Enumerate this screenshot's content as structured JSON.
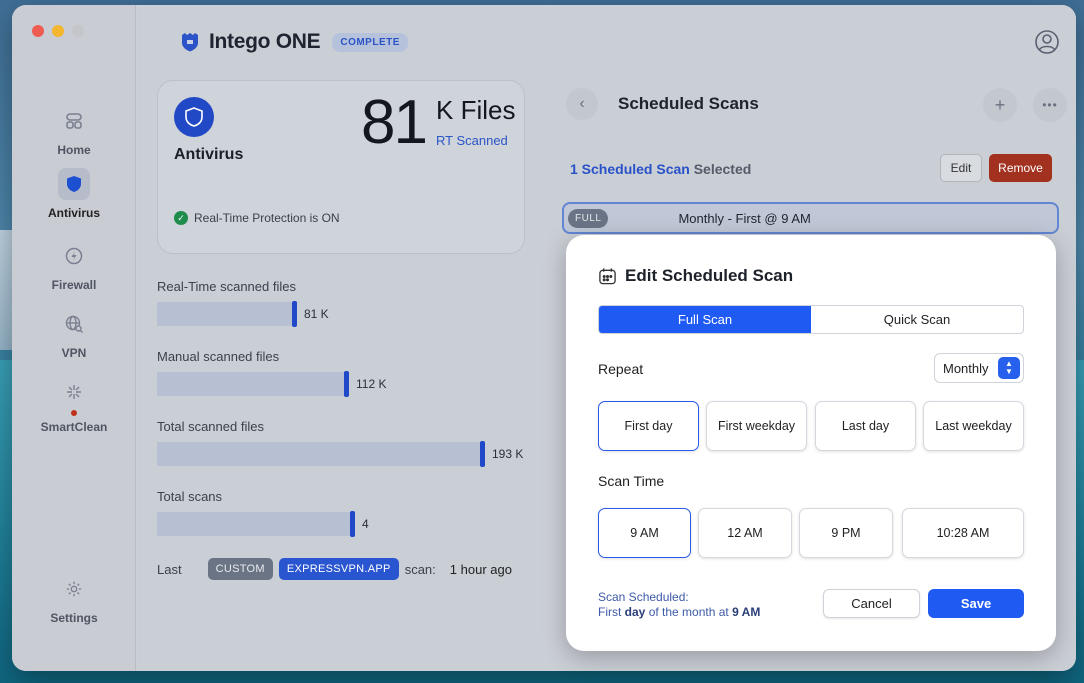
{
  "app": {
    "name": "Intego ONE",
    "edition": "COMPLETE"
  },
  "sidebar": {
    "items": [
      {
        "label": "Home",
        "icon": "home-grid-icon"
      },
      {
        "label": "Antivirus",
        "icon": "shield-icon",
        "active": true
      },
      {
        "label": "Firewall",
        "icon": "firewall-icon"
      },
      {
        "label": "VPN",
        "icon": "vpn-globe-icon"
      },
      {
        "label": "SmartClean",
        "icon": "sparkle-icon",
        "alert": true
      }
    ],
    "settings_label": "Settings"
  },
  "antivirus": {
    "title": "Antivirus",
    "count": "81",
    "count_unit": "K Files",
    "count_sub": "RT Scanned",
    "status": "Real-Time Protection is ON"
  },
  "stats": [
    {
      "label": "Real-Time scanned files",
      "value": "81 K",
      "fraction": 0.42
    },
    {
      "label": "Manual scanned files",
      "value": "112 K",
      "fraction": 0.58
    },
    {
      "label": "Total scanned files",
      "value": "193 K",
      "fraction": 1.0
    },
    {
      "label": "Total scans",
      "value": "4",
      "fraction": 0.6
    }
  ],
  "last_scan": {
    "prefix": "Last",
    "tag1": "CUSTOM",
    "tag2": "EXPRESSVPN.APP",
    "suffix": "scan:",
    "time": "1 hour ago"
  },
  "scheduled": {
    "title": "Scheduled Scans",
    "selected_count": "1 Scheduled Scan",
    "selected_suffix": "Selected",
    "edit_label": "Edit",
    "remove_label": "Remove",
    "row_badge": "FULL",
    "row_text": "Monthly - First @ 9 AM"
  },
  "modal": {
    "title": "Edit Scheduled Scan",
    "tabs": [
      "Full Scan",
      "Quick Scan"
    ],
    "active_tab": "Full Scan",
    "repeat_label": "Repeat",
    "repeat_value": "Monthly",
    "repeat_options": [
      "First day",
      "First weekday",
      "Last day",
      "Last weekday"
    ],
    "repeat_selected": "First day",
    "scan_time_label": "Scan Time",
    "time_options": [
      "9 AM",
      "12 AM",
      "9 PM",
      "10:28 AM"
    ],
    "time_selected": "9 AM",
    "summary_line1": "Scan Scheduled:",
    "summary_first": "First",
    "summary_day": "day",
    "summary_mid": "of the month at",
    "summary_time": "9 AM",
    "cancel_label": "Cancel",
    "save_label": "Save"
  },
  "colors": {
    "accent": "#1f5bf2",
    "remove": "#a3311f",
    "brand": "#2148c5"
  }
}
